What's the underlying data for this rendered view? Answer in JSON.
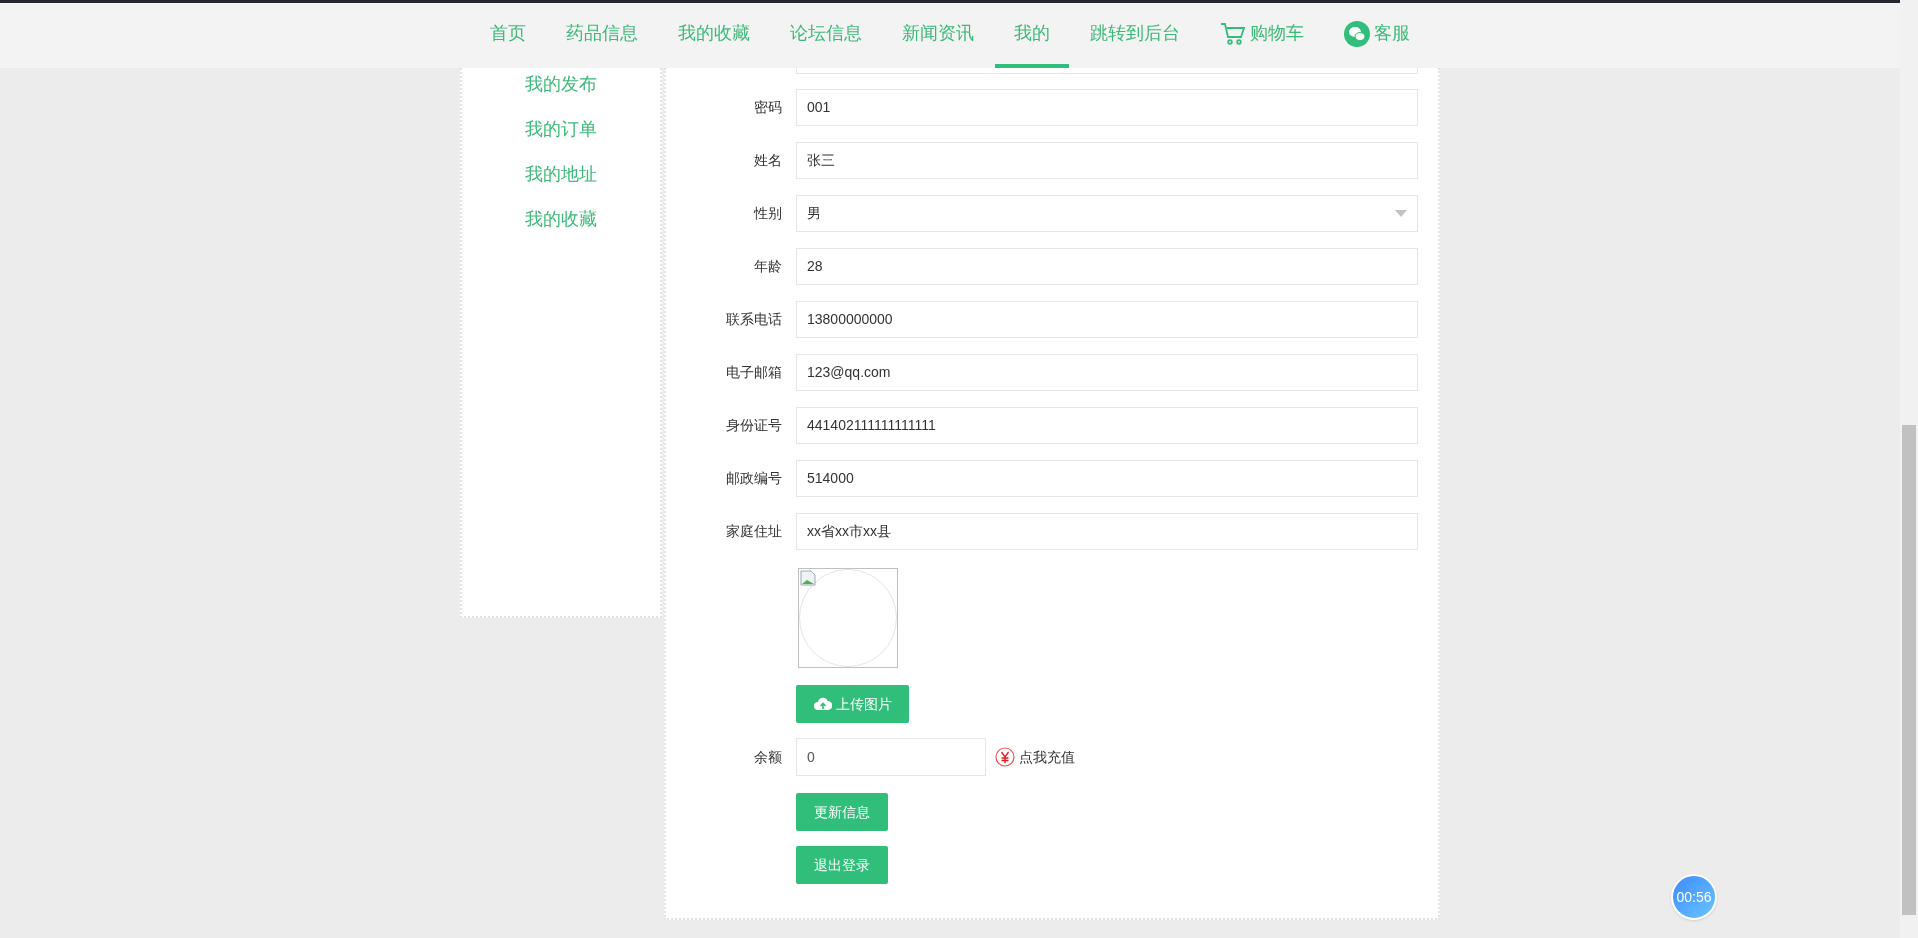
{
  "nav": [
    {
      "label": "首页",
      "selected": false,
      "kind": "link"
    },
    {
      "label": "药品信息",
      "selected": false,
      "kind": "link"
    },
    {
      "label": "我的收藏",
      "selected": false,
      "kind": "link"
    },
    {
      "label": "论坛信息",
      "selected": false,
      "kind": "link"
    },
    {
      "label": "新闻资讯",
      "selected": false,
      "kind": "link"
    },
    {
      "label": "我的",
      "selected": true,
      "kind": "link"
    },
    {
      "label": "跳转到后台",
      "selected": false,
      "kind": "link"
    },
    {
      "label": "购物车",
      "selected": false,
      "kind": "cart"
    },
    {
      "label": "客服",
      "selected": false,
      "kind": "chat"
    }
  ],
  "sidebar": {
    "items": [
      "我的发布",
      "我的订单",
      "我的地址",
      "我的收藏"
    ]
  },
  "form": {
    "fields": [
      {
        "label": "密码",
        "value": "001",
        "kind": "text"
      },
      {
        "label": "姓名",
        "value": "张三",
        "kind": "text"
      },
      {
        "label": "性别",
        "value": "男",
        "kind": "select"
      },
      {
        "label": "年龄",
        "value": "28",
        "kind": "text"
      },
      {
        "label": "联系电话",
        "value": "13800000000",
        "kind": "text"
      },
      {
        "label": "电子邮箱",
        "value": "123@qq.com",
        "kind": "text"
      },
      {
        "label": "身份证号",
        "value": "441402111111111111",
        "kind": "text"
      },
      {
        "label": "邮政编号",
        "value": "514000",
        "kind": "text"
      },
      {
        "label": "家庭住址",
        "value": "xx省xx市xx县",
        "kind": "text"
      }
    ],
    "upload_button": "上传图片",
    "balance": {
      "label": "余额",
      "value": "0",
      "recharge_link": "点我充值"
    },
    "buttons": [
      "更新信息",
      "退出登录"
    ]
  },
  "timer": "00:56"
}
